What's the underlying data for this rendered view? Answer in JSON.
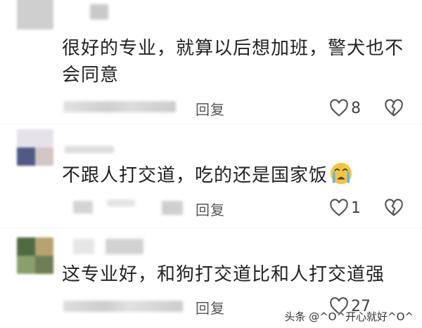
{
  "comments": [
    {
      "text": "很好的专业，就算以后想加班，警犬也不会同意",
      "reply_label": "回复",
      "like_count": "8"
    },
    {
      "text": "不跟人打交道，吃的还是国家饭",
      "emoji": "loudly-crying-face-emoji",
      "reply_label": "回复",
      "like_count": "1"
    },
    {
      "text": "这专业好，和狗打交道比和人打交道强",
      "reply_label": "回复",
      "like_count": "27"
    }
  ],
  "watermark": "头条 @^O^开心就好^O^",
  "colors": {
    "text": "#222222",
    "icon": "#555555",
    "background": "#ffffff"
  }
}
